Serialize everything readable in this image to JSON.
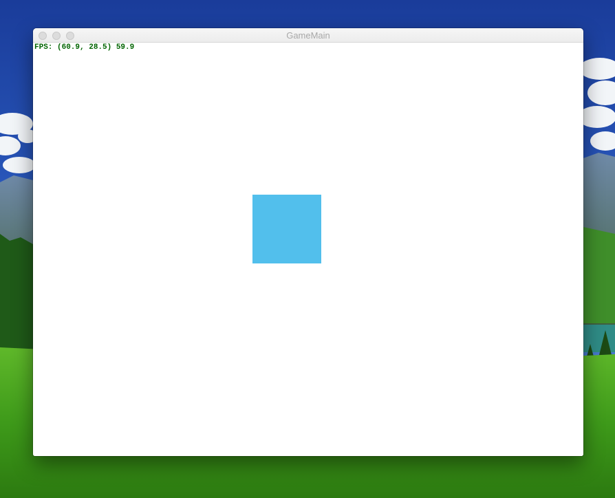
{
  "window": {
    "title": "GameMain",
    "controls": [
      "close",
      "minimize",
      "zoom"
    ]
  },
  "game": {
    "fps_overlay": "FPS: (60.9, 28.5) 59.9",
    "fps_color": "#006400",
    "background_color": "#ffffff",
    "square_color": "#52bfec"
  }
}
